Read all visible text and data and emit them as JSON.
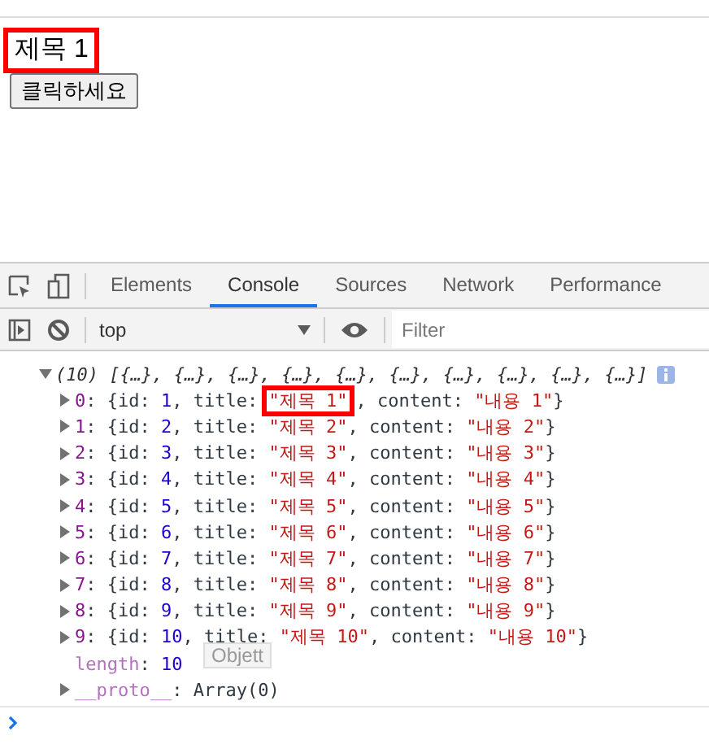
{
  "page": {
    "heading": "제목 1",
    "heading_highlighted": true,
    "button": "클릭하세요"
  },
  "devtools": {
    "tabs": [
      {
        "label": "Elements",
        "selected": false
      },
      {
        "label": "Console",
        "selected": true
      },
      {
        "label": "Sources",
        "selected": false
      },
      {
        "label": "Network",
        "selected": false
      },
      {
        "label": "Performance",
        "selected": false
      }
    ],
    "context": "top",
    "filter": {
      "placeholder": "Filter"
    },
    "console": {
      "summary": {
        "text": "(10) [{…}, {…}, {…}, {…}, {…}, {…}, {…}, {…}, {…}, {…}]",
        "expanded": true
      },
      "rows": [
        {
          "expanded": false,
          "parts": [
            {
              "kind": "key",
              "text": "0"
            },
            {
              "kind": "punct",
              "text": ": {id: "
            },
            {
              "kind": "number",
              "text": "1"
            },
            {
              "kind": "punct",
              "text": ", title: "
            },
            {
              "kind": "string",
              "text": "\"제목 1\"",
              "highlighted": true
            },
            {
              "kind": "punct",
              "text": ", content: "
            },
            {
              "kind": "string",
              "text": "\"내용 1\""
            },
            {
              "kind": "punct",
              "text": "}"
            }
          ]
        },
        {
          "expanded": false,
          "parts": [
            {
              "kind": "key",
              "text": "1"
            },
            {
              "kind": "punct",
              "text": ": {id: "
            },
            {
              "kind": "number",
              "text": "2"
            },
            {
              "kind": "punct",
              "text": ", title: "
            },
            {
              "kind": "string",
              "text": "\"제목 2\""
            },
            {
              "kind": "punct",
              "text": ", content: "
            },
            {
              "kind": "string",
              "text": "\"내용 2\""
            },
            {
              "kind": "punct",
              "text": "}"
            }
          ]
        },
        {
          "expanded": false,
          "parts": [
            {
              "kind": "key",
              "text": "2"
            },
            {
              "kind": "punct",
              "text": ": {id: "
            },
            {
              "kind": "number",
              "text": "3"
            },
            {
              "kind": "punct",
              "text": ", title: "
            },
            {
              "kind": "string",
              "text": "\"제목 3\""
            },
            {
              "kind": "punct",
              "text": ", content: "
            },
            {
              "kind": "string",
              "text": "\"내용 3\""
            },
            {
              "kind": "punct",
              "text": "}"
            }
          ]
        },
        {
          "expanded": false,
          "parts": [
            {
              "kind": "key",
              "text": "3"
            },
            {
              "kind": "punct",
              "text": ": {id: "
            },
            {
              "kind": "number",
              "text": "4"
            },
            {
              "kind": "punct",
              "text": ", title: "
            },
            {
              "kind": "string",
              "text": "\"제목 4\""
            },
            {
              "kind": "punct",
              "text": ", content: "
            },
            {
              "kind": "string",
              "text": "\"내용 4\""
            },
            {
              "kind": "punct",
              "text": "}"
            }
          ]
        },
        {
          "expanded": false,
          "parts": [
            {
              "kind": "key",
              "text": "4"
            },
            {
              "kind": "punct",
              "text": ": {id: "
            },
            {
              "kind": "number",
              "text": "5"
            },
            {
              "kind": "punct",
              "text": ", title: "
            },
            {
              "kind": "string",
              "text": "\"제목 5\""
            },
            {
              "kind": "punct",
              "text": ", content: "
            },
            {
              "kind": "string",
              "text": "\"내용 5\""
            },
            {
              "kind": "punct",
              "text": "}"
            }
          ]
        },
        {
          "expanded": false,
          "parts": [
            {
              "kind": "key",
              "text": "5"
            },
            {
              "kind": "punct",
              "text": ": {id: "
            },
            {
              "kind": "number",
              "text": "6"
            },
            {
              "kind": "punct",
              "text": ", title: "
            },
            {
              "kind": "string",
              "text": "\"제목 6\""
            },
            {
              "kind": "punct",
              "text": ", content: "
            },
            {
              "kind": "string",
              "text": "\"내용 6\""
            },
            {
              "kind": "punct",
              "text": "}"
            }
          ]
        },
        {
          "expanded": false,
          "parts": [
            {
              "kind": "key",
              "text": "6"
            },
            {
              "kind": "punct",
              "text": ": {id: "
            },
            {
              "kind": "number",
              "text": "7"
            },
            {
              "kind": "punct",
              "text": ", title: "
            },
            {
              "kind": "string",
              "text": "\"제목 7\""
            },
            {
              "kind": "punct",
              "text": ", content: "
            },
            {
              "kind": "string",
              "text": "\"내용 7\""
            },
            {
              "kind": "punct",
              "text": "}"
            }
          ]
        },
        {
          "expanded": false,
          "parts": [
            {
              "kind": "key",
              "text": "7"
            },
            {
              "kind": "punct",
              "text": ": {id: "
            },
            {
              "kind": "number",
              "text": "8"
            },
            {
              "kind": "punct",
              "text": ", title: "
            },
            {
              "kind": "string",
              "text": "\"제목 8\""
            },
            {
              "kind": "punct",
              "text": ", content: "
            },
            {
              "kind": "string",
              "text": "\"내용 8\""
            },
            {
              "kind": "punct",
              "text": "}"
            }
          ]
        },
        {
          "expanded": false,
          "parts": [
            {
              "kind": "key",
              "text": "8"
            },
            {
              "kind": "punct",
              "text": ": {id: "
            },
            {
              "kind": "number",
              "text": "9"
            },
            {
              "kind": "punct",
              "text": ", title: "
            },
            {
              "kind": "string",
              "text": "\"제목 9\""
            },
            {
              "kind": "punct",
              "text": ", content: "
            },
            {
              "kind": "string",
              "text": "\"내용 9\""
            },
            {
              "kind": "punct",
              "text": "}"
            }
          ]
        },
        {
          "expanded": false,
          "tooltip": "Objett",
          "parts": [
            {
              "kind": "key",
              "text": "9"
            },
            {
              "kind": "punct",
              "text": ": {id: "
            },
            {
              "kind": "number",
              "text": "10"
            },
            {
              "kind": "punct",
              "text": ", title: "
            },
            {
              "kind": "string",
              "text": "\"제목 10\""
            },
            {
              "kind": "punct",
              "text": ", content: "
            },
            {
              "kind": "string",
              "text": "\"내용 10\""
            },
            {
              "kind": "punct",
              "text": "}"
            }
          ]
        },
        {
          "parts": [
            {
              "kind": "meta",
              "text": "length"
            },
            {
              "kind": "punct",
              "text": ": "
            },
            {
              "kind": "number",
              "text": "10"
            }
          ]
        },
        {
          "expanded": false,
          "parts": [
            {
              "kind": "meta",
              "text": "__proto__"
            },
            {
              "kind": "punct",
              "text": ": Array(0)"
            }
          ]
        }
      ]
    }
  }
}
